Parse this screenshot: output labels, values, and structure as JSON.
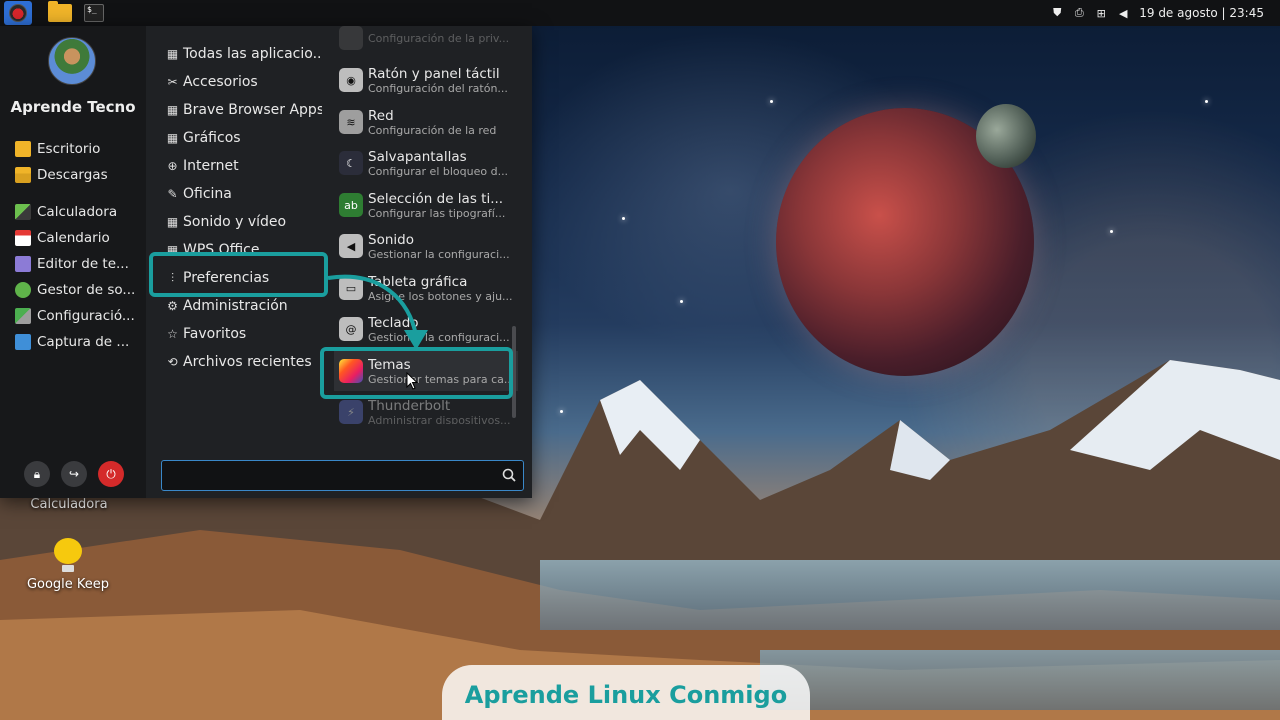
{
  "top_panel": {
    "datetime": "19 de agosto | 23:45",
    "tray_icons": [
      "shield-icon",
      "printer-icon",
      "network-icon",
      "volume-icon"
    ]
  },
  "desktop": {
    "icons": [
      {
        "label": "Calculadora"
      },
      {
        "label": "Google Keep"
      }
    ]
  },
  "menu": {
    "user_name": "Aprende Tecno",
    "favorites": [
      {
        "label": "Escritorio",
        "icon": "folder-icon"
      },
      {
        "label": "Descargas",
        "icon": "download-folder-icon"
      },
      {
        "label": "Calculadora",
        "icon": "calculator-icon"
      },
      {
        "label": "Calendario",
        "icon": "calendar-icon"
      },
      {
        "label": "Editor de te...",
        "icon": "text-editor-icon"
      },
      {
        "label": "Gestor de so...",
        "icon": "software-manager-icon"
      },
      {
        "label": "Configuració...",
        "icon": "settings-icon"
      },
      {
        "label": "Captura de ...",
        "icon": "screenshot-icon"
      }
    ],
    "categories": [
      {
        "label": "Todas las aplicacio...",
        "icon": "grid-icon",
        "glyph": "▦"
      },
      {
        "label": "Accesorios",
        "icon": "tools-icon",
        "glyph": "✂"
      },
      {
        "label": "Brave Browser Apps",
        "icon": "grid-icon",
        "glyph": "▦"
      },
      {
        "label": "Gráficos",
        "icon": "grid-icon",
        "glyph": "▦"
      },
      {
        "label": "Internet",
        "icon": "globe-icon",
        "glyph": "⊕"
      },
      {
        "label": "Oficina",
        "icon": "brush-icon",
        "glyph": "✎"
      },
      {
        "label": "Sonido y vídeo",
        "icon": "grid-icon",
        "glyph": "▦"
      },
      {
        "label": "WPS Office",
        "icon": "grid-icon",
        "glyph": "▦"
      },
      {
        "label": "Preferencias",
        "icon": "sliders-icon",
        "glyph": "⫶"
      },
      {
        "label": "Administración",
        "icon": "gear-icon",
        "glyph": "⚙"
      },
      {
        "label": "Favoritos",
        "icon": "star-icon",
        "glyph": "☆"
      },
      {
        "label": "Archivos recientes",
        "icon": "history-icon",
        "glyph": "⟲"
      }
    ],
    "apps": [
      {
        "name": "",
        "desc": "Configuración de la priv...",
        "icon": "privacy-icon",
        "color": "#555555"
      },
      {
        "name": "Ratón y panel táctil",
        "desc": "Configuración del ratón...",
        "icon": "mouse-icon",
        "color": "#bdbdbd"
      },
      {
        "name": "Red",
        "desc": "Configuración de la red",
        "icon": "wifi-icon",
        "color": "#9e9e9e"
      },
      {
        "name": "Salvapantallas",
        "desc": "Configurar el bloqueo d...",
        "icon": "moon-icon",
        "color": "#2b2d3a"
      },
      {
        "name": "Selección de las ti...",
        "desc": "Configurar las tipografí...",
        "icon": "font-icon",
        "color": "#2e7d32"
      },
      {
        "name": "Sonido",
        "desc": "Gestionar la configuraci...",
        "icon": "speaker-icon",
        "color": "#bdbdbd"
      },
      {
        "name": "Tableta gráfica",
        "desc": "Asigne los botones y aju...",
        "icon": "tablet-icon",
        "color": "#bdbdbd"
      },
      {
        "name": "Teclado",
        "desc": "Gestionar la configuraci...",
        "icon": "keyboard-icon",
        "color": "#bdbdbd"
      },
      {
        "name": "Temas",
        "desc": "Gestionar temas para ca...",
        "icon": "theme-icon",
        "color": "#ff6f61"
      },
      {
        "name": "Thunderbolt",
        "desc": "Administrar dispositivos...",
        "icon": "thunderbolt-icon",
        "color": "#5c6bc0"
      }
    ],
    "search": {
      "value": "",
      "placeholder": ""
    }
  },
  "watermark": "Aprende Linux Conmigo",
  "colors": {
    "panel_bg": "#111214",
    "menu_bg": "#1f2124",
    "accent_highlight": "#1a9e9e",
    "search_border": "#3a88c9",
    "power_button": "#d42a2a"
  }
}
